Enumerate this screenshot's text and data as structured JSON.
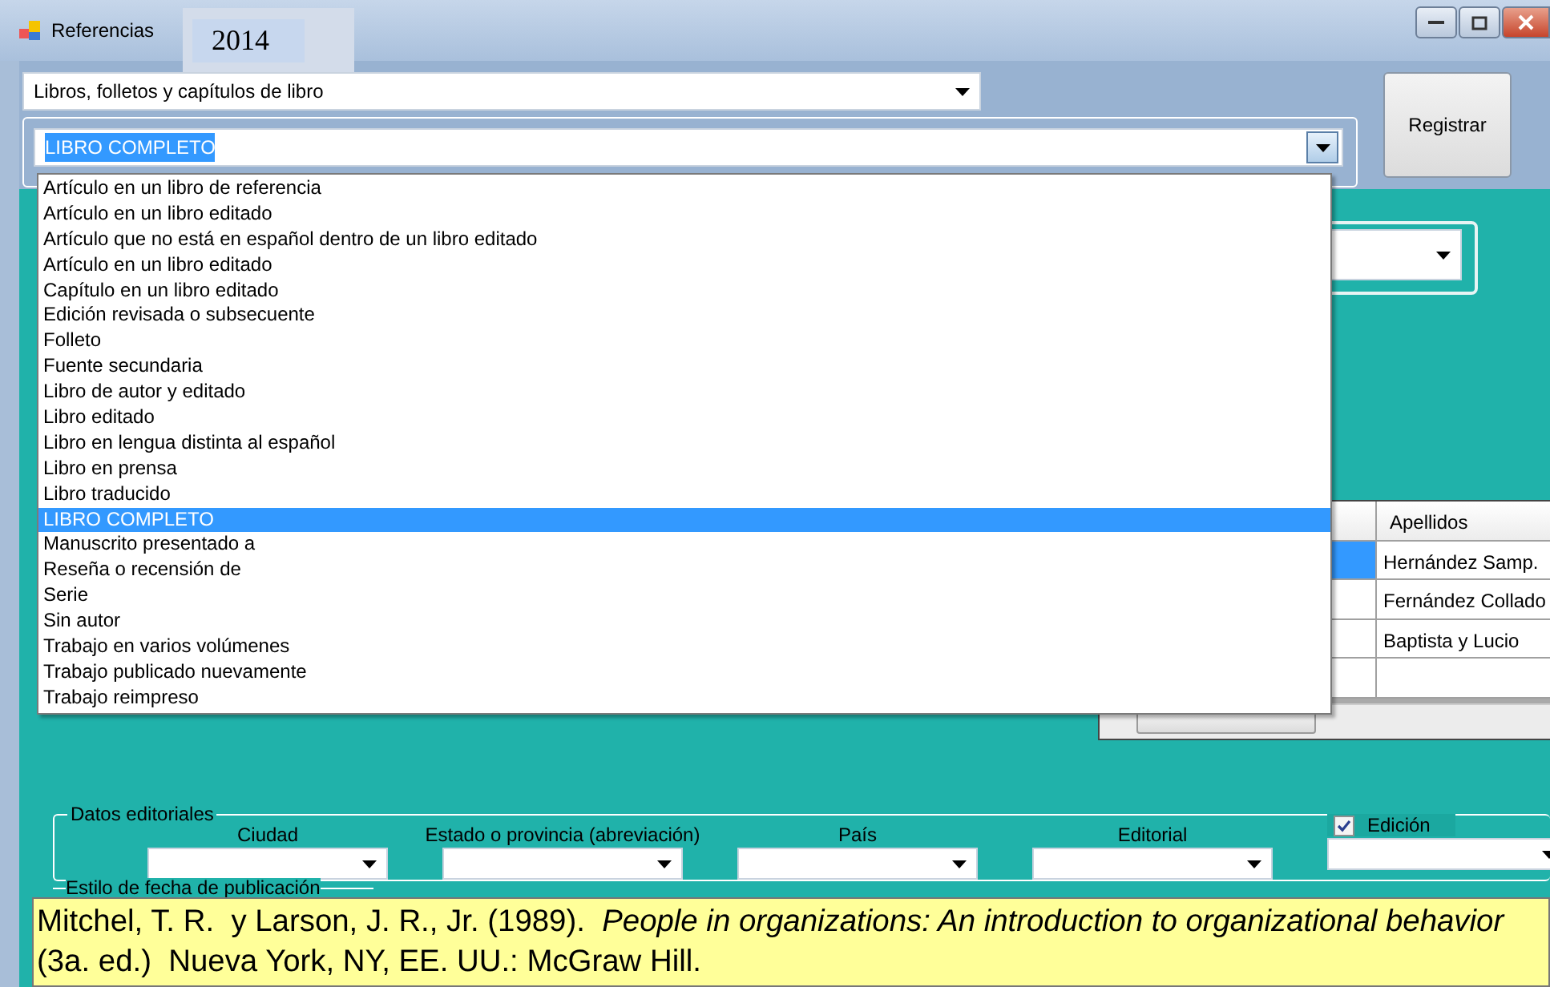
{
  "window": {
    "title": "Referencias",
    "overlay_label": "2014"
  },
  "category_combo": {
    "value": "Libros, folletos y capítulos de libro"
  },
  "type_combo": {
    "value": "LIBRO COMPLETO",
    "expanded": true,
    "options": [
      {
        "label": "Artículo en un libro de referencia",
        "selected": false
      },
      {
        "label": "Artículo en un libro editado",
        "selected": false
      },
      {
        "label": "Artículo que no está en español dentro de un libro editado",
        "selected": false
      },
      {
        "label": "Artículo en un libro editado",
        "selected": false
      },
      {
        "label": "Capítulo en un libro editado",
        "selected": false
      },
      {
        "label": "Edición revisada o subsecuente",
        "selected": false
      },
      {
        "label": "Folleto",
        "selected": false
      },
      {
        "label": "Fuente secundaria",
        "selected": false
      },
      {
        "label": "Libro de autor y editado",
        "selected": false
      },
      {
        "label": "Libro editado",
        "selected": false
      },
      {
        "label": "Libro en lengua distinta al español",
        "selected": false
      },
      {
        "label": "Libro en prensa",
        "selected": false
      },
      {
        "label": "Libro traducido",
        "selected": false
      },
      {
        "label": "LIBRO COMPLETO",
        "selected": true
      },
      {
        "label": "Manuscrito presentado a",
        "selected": false
      },
      {
        "label": "Reseña o recensión de",
        "selected": false
      },
      {
        "label": "Serie",
        "selected": false
      },
      {
        "label": "Sin autor",
        "selected": false
      },
      {
        "label": "Trabajo en varios volúmenes",
        "selected": false
      },
      {
        "label": "Trabajo publicado nuevamente",
        "selected": false
      },
      {
        "label": "Trabajo reimpreso",
        "selected": false
      }
    ]
  },
  "register_button": "Registrar",
  "authors_grid": {
    "columns": [
      "Apellidos"
    ],
    "rows": [
      {
        "apellidos": "Hernández Samp.",
        "selected": true
      },
      {
        "apellidos": "Fernández Collado",
        "selected": false
      },
      {
        "apellidos": "Baptista y Lucio",
        "selected": false
      }
    ]
  },
  "publisher_data": {
    "legend": "Datos editoriales",
    "fields": [
      {
        "label": "Ciudad",
        "kind": "combo"
      },
      {
        "label": "Estado o provincia  (abreviación)",
        "kind": "combo"
      },
      {
        "label": "País",
        "kind": "combo"
      },
      {
        "label": "Editorial",
        "kind": "combo"
      },
      {
        "label": "Edición",
        "kind": "checkbox",
        "checked": true
      }
    ]
  },
  "date_style": {
    "legend": "Estilo de fecha de publicación"
  },
  "citation": "Mitchel, T. R.  y Larson, J. R., Jr. (1989).  *People in organizations: An introduction to organizational behavior* (3a. ed.)  Nueva York, NY, EE. UU.: McGraw Hill."
}
